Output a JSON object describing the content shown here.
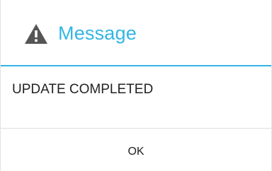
{
  "dialog": {
    "title": "Message",
    "title_icon": "warning-icon",
    "message": "UPDATE COMPLETED",
    "ok_label": "OK"
  },
  "colors": {
    "accent": "#33b5e5",
    "text": "#222222",
    "icon": "#555555",
    "divider": "#dedede",
    "background": "#ffffff"
  }
}
